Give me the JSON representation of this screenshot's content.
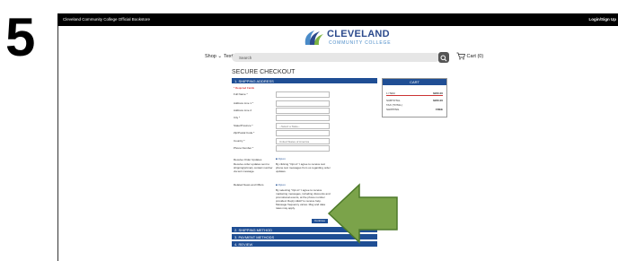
{
  "step": "5",
  "topbar": {
    "store_name": "Cleveland Community College Official Bookstore",
    "login": "Login/Sign Up"
  },
  "logo": {
    "line1": "CLEVELAND",
    "line2": "COMMUNITY COLLEGE",
    "colors": {
      "dark": "#2c4a8c",
      "light": "#4a8bc8",
      "green": "#7cb342"
    }
  },
  "nav": {
    "shop": "Shop",
    "textbooks": "Textbooks",
    "search_placeholder": "Search",
    "cart": "Cart (0)"
  },
  "checkout": {
    "title": "SECURE CHECKOUT",
    "step1": "1. SHIPPING ADDRESS",
    "required_note": "* Required Fields",
    "fields": [
      {
        "label": "Full Name *",
        "value": ""
      },
      {
        "label": "Address Line 1 *",
        "value": ""
      },
      {
        "label": "Address Line 2",
        "value": ""
      },
      {
        "label": "City *",
        "value": ""
      },
      {
        "label": "State/Province *",
        "value": "--Select a State--"
      },
      {
        "label": "Zip/Postal Code *",
        "value": ""
      },
      {
        "label": "Country *",
        "value": "United States of America"
      },
      {
        "label": "Phone Number *",
        "value": ""
      }
    ],
    "order_updates": {
      "label": "Receive Order Updates",
      "sub": "Receive order updates sent to shipping/primary contact number via text message.",
      "checkbox": "Opt-in",
      "text": "By clicking \"Opt-in\" I agree to receive text phone text messages from us regarding order updates."
    },
    "news": {
      "label": "Related News and Offers",
      "checkbox": "Opt-in",
      "text": "By selecting \"Opt-in\" I agree to receive marketing messages, including discounts and promotional events, at the phone number provided. Reply HELP to receive help. Message frequency varies. Msg and data rates may apply."
    },
    "continue": "Continue",
    "step2": "2. SHIPPING METHOD",
    "step3": "3. PAYMENT METHODS",
    "step4": "4. REVIEW"
  },
  "cart": {
    "title": "CART",
    "rows": [
      {
        "label": "1 ITEM",
        "value": "$260.00"
      },
      {
        "label": "SUBTOTAL",
        "value": "$260.00"
      },
      {
        "label": "TAX (TOTAL)",
        "value": ""
      },
      {
        "label": "SHIPPING",
        "value": "FREE"
      }
    ]
  },
  "arrow_color": "#7ba34a"
}
